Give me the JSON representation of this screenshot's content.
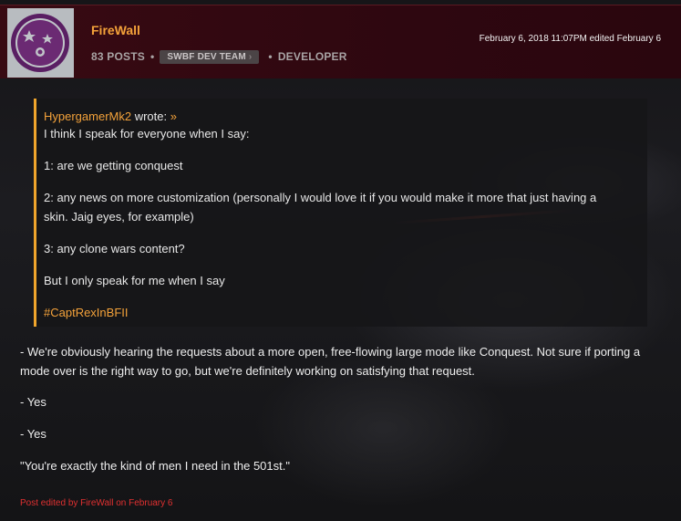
{
  "post": {
    "author": "FireWall",
    "posts_count": "83 POSTS",
    "team_badge": "SWBF DEV TEAM",
    "team_badge_chevron": "›",
    "role": "DEVELOPER",
    "separator": "•",
    "timestamp": "February 6, 2018 11:07PM edited February 6",
    "avatar_colors": {
      "bg": "#b8bcc0",
      "ring": "#5a1f63",
      "inner": "#6b2a73"
    }
  },
  "quote": {
    "author": "HypergamerMk2",
    "wrote": "wrote:",
    "arrow": "»",
    "lines": [
      "I think I speak for everyone when I say:",
      "1: are we getting conquest",
      "2: any news on more customization (personally I would love it if you would make it more that just having a",
      "skin. Jaig eyes, for example)",
      "3: any clone wars content?",
      "But I only speak for me when I say"
    ],
    "hashtag": "#CaptRexInBFII"
  },
  "reply": {
    "lines": [
      "- We're obviously hearing the requests about a more open, free-flowing large mode like Conquest. Not sure if porting a",
      "mode over is the right way to go, but we're definitely working on satisfying that request.",
      "- Yes",
      "- Yes",
      "\"You're exactly the kind of men I need in the 501st.\""
    ],
    "edited_note": "Post edited by FireWall on February 6"
  },
  "colors": {
    "accent": "#f4a23a",
    "header_bg": "#380a12",
    "edited_red": "#e03030"
  }
}
